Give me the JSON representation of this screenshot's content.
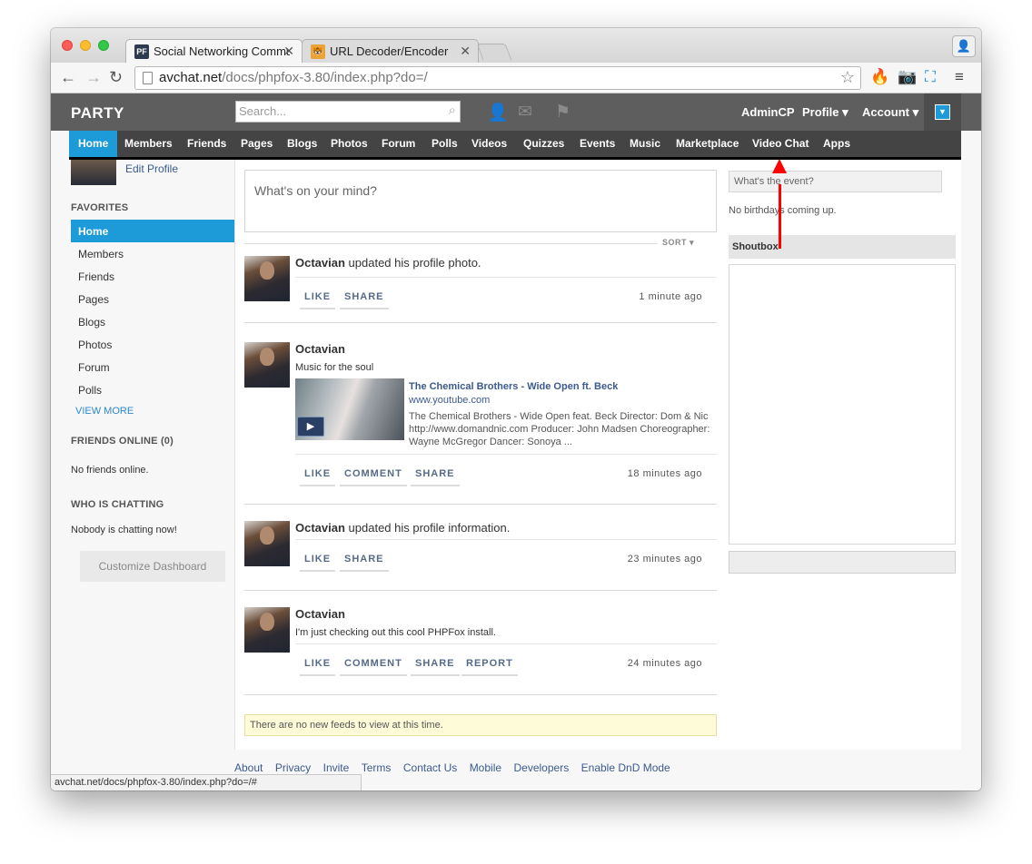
{
  "browser": {
    "tabs": [
      {
        "title": "Social Networking Commu",
        "favicon": "PF"
      },
      {
        "title": "URL Decoder/Encoder",
        "favicon": "tiger"
      }
    ],
    "url_host": "avchat.net",
    "url_path": "/docs/phpfox-3.80/index.php?do=/",
    "status_url": "avchat.net/docs/phpfox-3.80/index.php?do=/#"
  },
  "header": {
    "site_title": "PARTY",
    "search_placeholder": "Search...",
    "admincp": "AdminCP",
    "profile": "Profile",
    "account": "Account"
  },
  "menu": [
    "Home",
    "Members",
    "Friends",
    "Pages",
    "Blogs",
    "Photos",
    "Forum",
    "Polls",
    "Videos",
    "Quizzes",
    "Events",
    "Music",
    "Marketplace",
    "Video Chat",
    "Apps"
  ],
  "sidebar": {
    "edit_profile": "Edit Profile",
    "favorites_heading": "FAVORITES",
    "items": [
      "Home",
      "Members",
      "Friends",
      "Pages",
      "Blogs",
      "Photos",
      "Forum",
      "Polls"
    ],
    "view_more": "VIEW MORE",
    "friends_online_heading": "FRIENDS ONLINE (0)",
    "no_friends": "No friends online.",
    "who_chatting_heading": "WHO IS CHATTING",
    "nobody_chatting": "Nobody is chatting now!",
    "customize": "Customize Dashboard"
  },
  "main": {
    "status_placeholder": "What's on your mind?",
    "sort": "SORT",
    "feeds": [
      {
        "author": "Octavian",
        "text": " updated his profile photo.",
        "actions": [
          "LIKE",
          "SHARE"
        ],
        "time": "1 minute ago"
      },
      {
        "author": "Octavian",
        "text": "",
        "sub": "Music for the soul",
        "link_title": "The Chemical Brothers - Wide Open ft. Beck",
        "link_url": "www.youtube.com",
        "link_desc": "The Chemical Brothers - Wide Open feat. Beck Director: Dom & Nic http://www.domandnic.com Producer: John Madsen Choreographer: Wayne McGregor Dancer: Sonoya ...",
        "actions": [
          "LIKE",
          "COMMENT",
          "SHARE"
        ],
        "time": "18 minutes ago"
      },
      {
        "author": "Octavian",
        "text": " updated his profile information.",
        "actions": [
          "LIKE",
          "SHARE"
        ],
        "time": "23 minutes ago"
      },
      {
        "author": "Octavian",
        "text": "",
        "sub": "I'm just checking out this cool PHPFox install.",
        "actions": [
          "LIKE",
          "COMMENT",
          "SHARE",
          "REPORT"
        ],
        "time": "24 minutes ago"
      }
    ],
    "no_feeds": "There are no new feeds to view at this time."
  },
  "right": {
    "event_placeholder": "What's the event?",
    "no_birthdays": "No birthdays coming up.",
    "shoutbox": "Shoutbox"
  },
  "footer": [
    "About",
    "Privacy",
    "Invite",
    "Terms",
    "Contact Us",
    "Mobile",
    "Developers",
    "Enable DnD Mode"
  ],
  "colors": {
    "accent": "#1c9bd8",
    "topbar": "#5e5e5e",
    "menubar": "#444444",
    "annotation_arrow": "#ff0000"
  }
}
